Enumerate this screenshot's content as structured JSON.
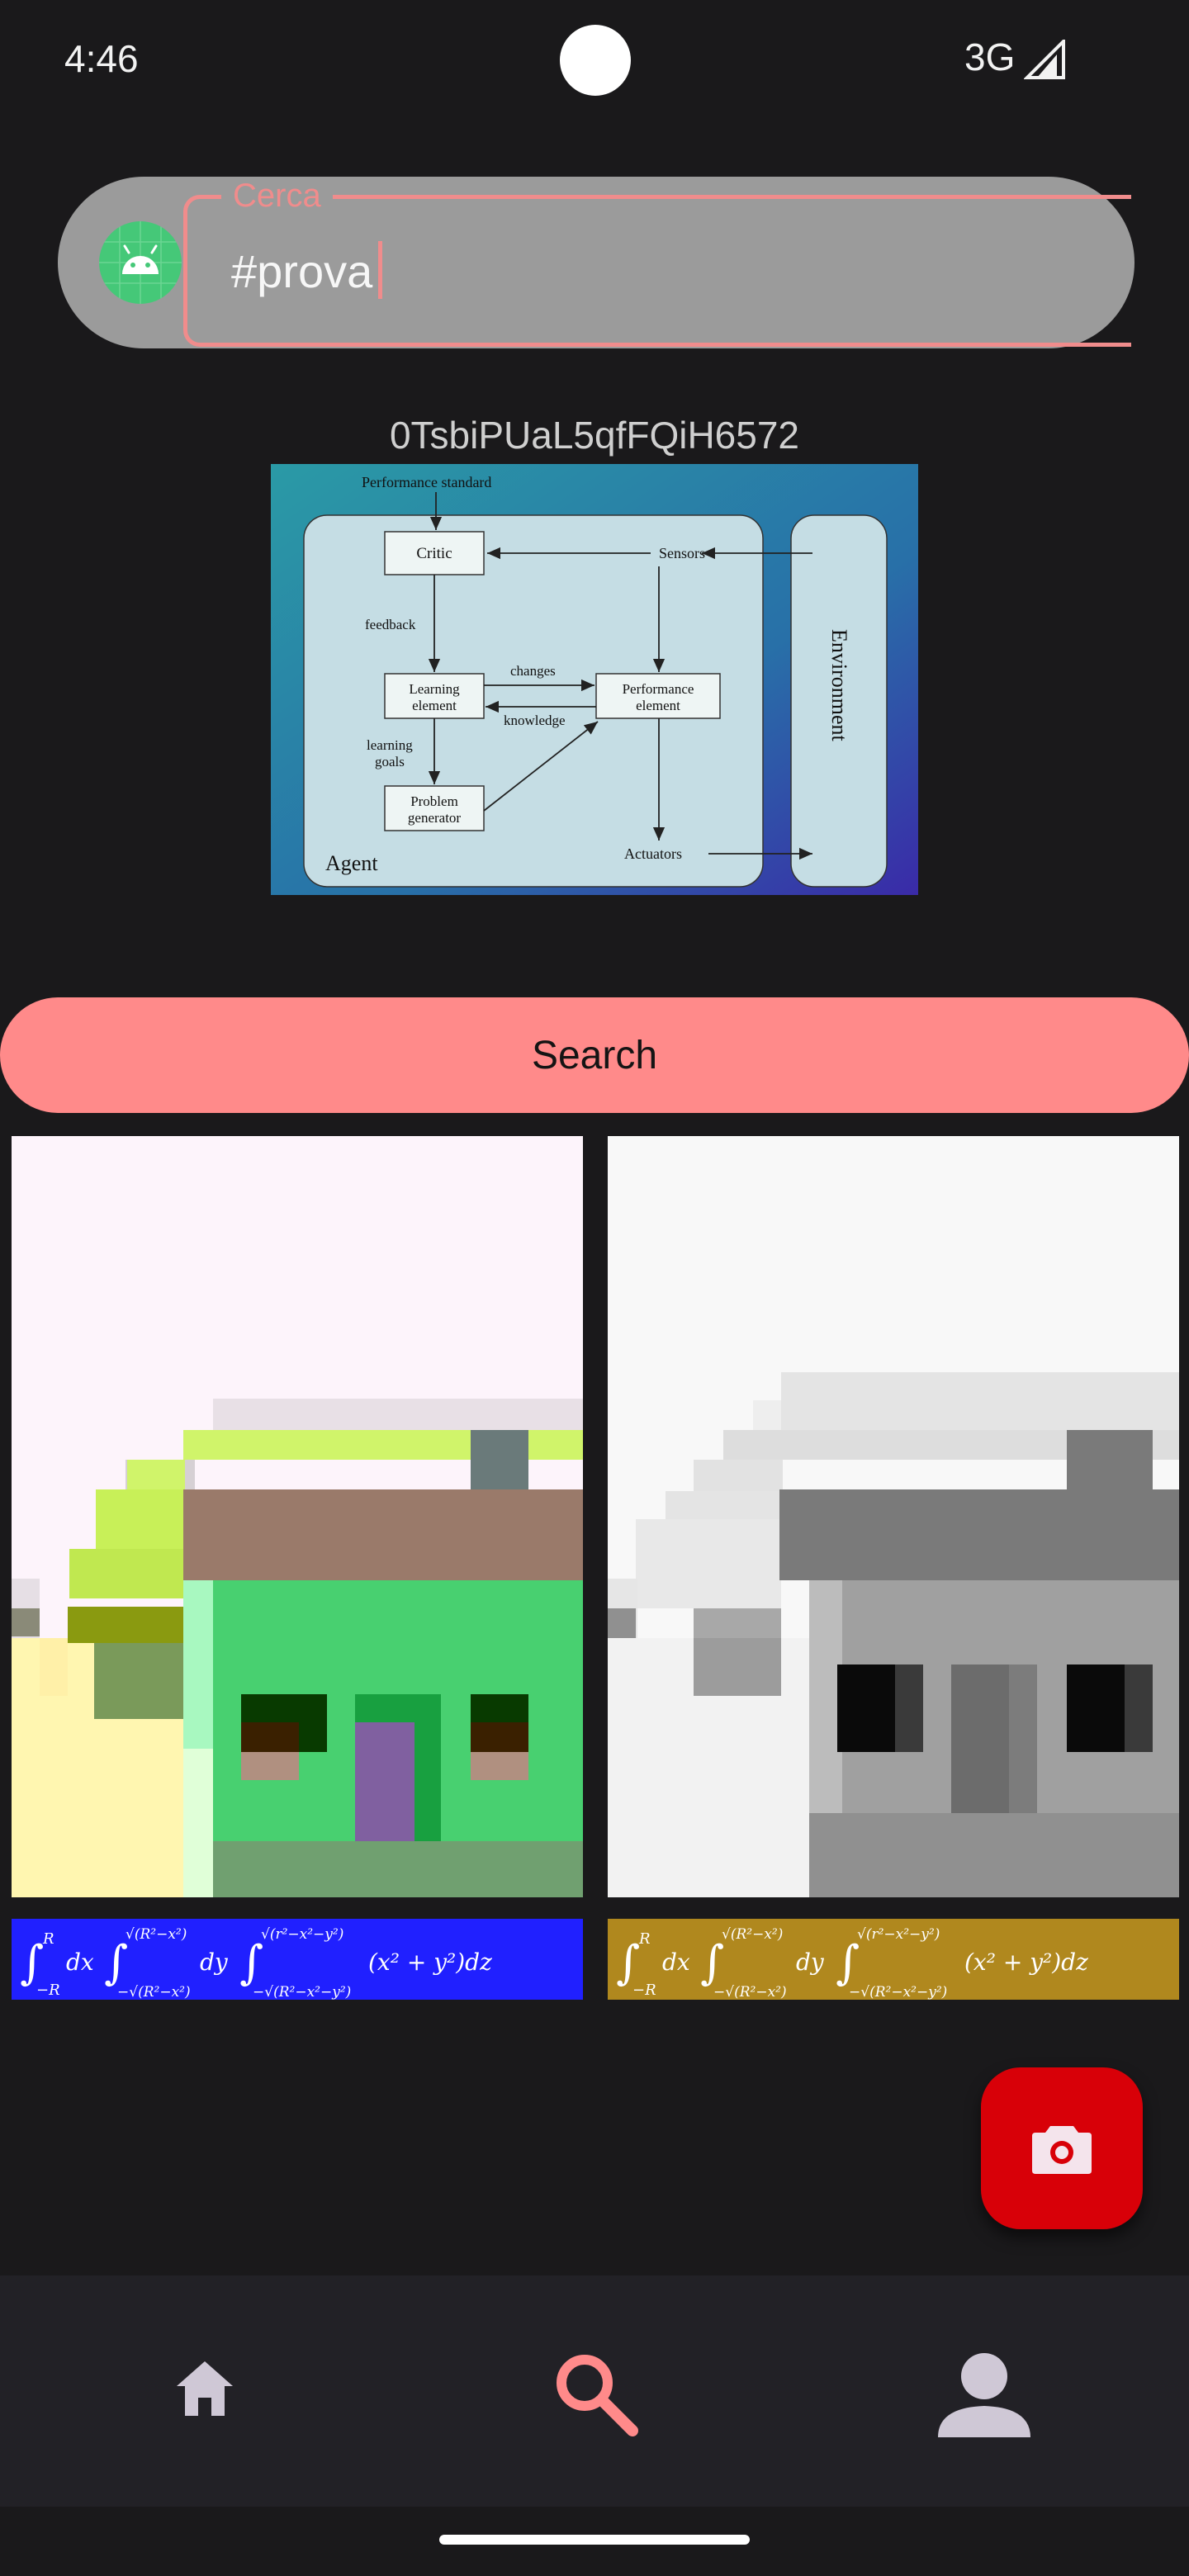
{
  "status_bar": {
    "time": "4:46",
    "network": "3G",
    "signal_icon": "signal-icon"
  },
  "search": {
    "label": "Cerca",
    "value": "#prova",
    "avatar_icon": "android-icon",
    "outline_color": "#f08c8c"
  },
  "result_header": {
    "id": "0TsbiPUaL5qfFQiH6572"
  },
  "diagram": {
    "top_label": "Performance standard",
    "critic": "Critic",
    "sensors": "Sensors",
    "feedback": "feedback",
    "changes": "changes",
    "knowledge": "knowledge",
    "learning_1": "Learning",
    "learning_2": "element",
    "perf_1": "Performance",
    "perf_2": "element",
    "goals_1": "learning",
    "goals_2": "goals",
    "problem_1": "Problem",
    "problem_2": "generator",
    "agent": "Agent",
    "actuators": "Actuators",
    "environment": "Environment"
  },
  "search_button": {
    "label": "Search",
    "color": "#ff8a8a"
  },
  "results": [
    {
      "formula_bg": "#2020ff",
      "image": "pixel-house-color"
    },
    {
      "formula_bg": "#b0881e",
      "image": "pixel-house-gray"
    }
  ],
  "formula": {
    "int1": "∫",
    "lim1_top": "R",
    "lim1_bot": "−R",
    "dx": "dx",
    "int2": "∫",
    "lim2_top": "√(R²−x²)",
    "lim2_bot": "−√(R²−x²)",
    "dy": "dy",
    "int3": "∫",
    "lim3_top": "√(r²−x²−y²)",
    "lim3_bot": "−√(R²−x²−y²)",
    "integrand": "(x² + y²)dz"
  },
  "fab": {
    "icon": "camera-icon",
    "color": "#d80008"
  },
  "bottom_nav": {
    "items": [
      {
        "icon": "home-icon",
        "active": false
      },
      {
        "icon": "search-icon",
        "active": true
      },
      {
        "icon": "person-icon",
        "active": false
      }
    ]
  }
}
